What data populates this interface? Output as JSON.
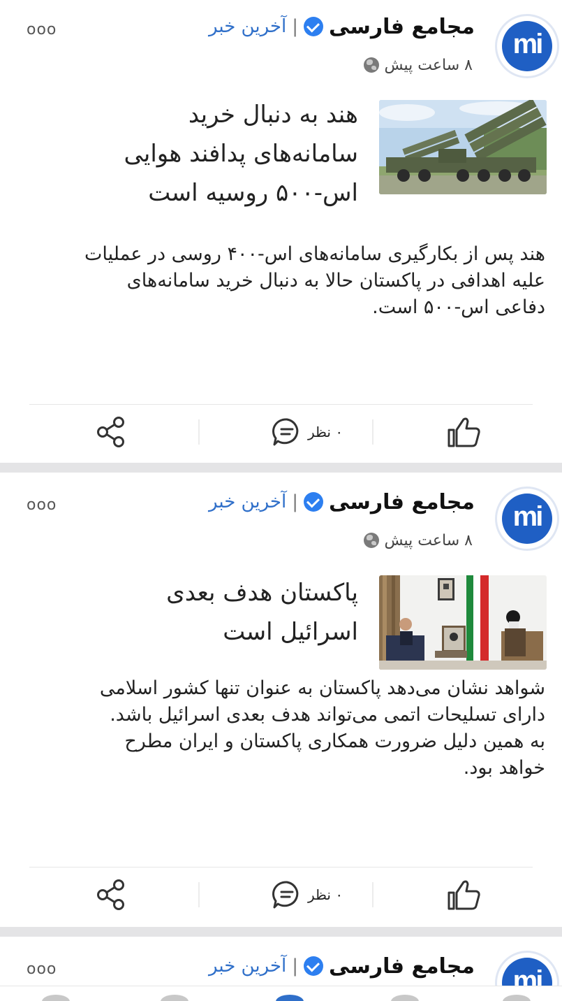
{
  "header": {
    "page_name": "مجامع فارسی",
    "separator": "|",
    "category_link": "آخرین خبر",
    "more_label": "ooo",
    "avatar_text": "mi"
  },
  "colors": {
    "accent": "#2f6fc9",
    "verified": "#2d7ff0",
    "avatar_bg": "#1f5fc4",
    "divider": "#e4e4e6"
  },
  "posts": [
    {
      "time_ago": "۸ ساعت پیش",
      "headline_lines": [
        "هند به دنبال خرید",
        "سامانه‌های پدافند هوایی",
        "اس-۵۰۰ روسیه است"
      ],
      "body_lines": [
        "هند پس از بکارگیری سامانه‌های اس-۴۰۰ روسی در عملیات",
        "علیه اهدافی در پاکستان حالا به دنبال خرید سامانه‌های",
        "دفاعی اس-۵۰۰ است."
      ],
      "comment_count": "۰ نظر",
      "image_subject": "missile-launcher-trucks"
    },
    {
      "time_ago": "۸ ساعت پیش",
      "headline_lines": [
        "پاکستان هدف بعدی",
        "اسرائیل است"
      ],
      "body_lines": [
        "شواهد نشان می‌دهد پاکستان به عنوان تنها کشور اسلامی",
        "دارای تسلیحات اتمی می‌تواند هدف بعدی اسرائیل باشد.",
        "به همین دلیل ضرورت همکاری پاکستان و ایران مطرح",
        "خواهد بود."
      ],
      "comment_count": "۰ نظر",
      "image_subject": "two-men-meeting-with-flag"
    },
    {
      "partial": true
    }
  ],
  "icons": {
    "like": "thumbs-up-icon",
    "comment": "comment-bubble-icon",
    "share": "share-icon",
    "verified": "verified-badge-icon",
    "globe": "globe-icon",
    "more": "more-options-icon"
  }
}
